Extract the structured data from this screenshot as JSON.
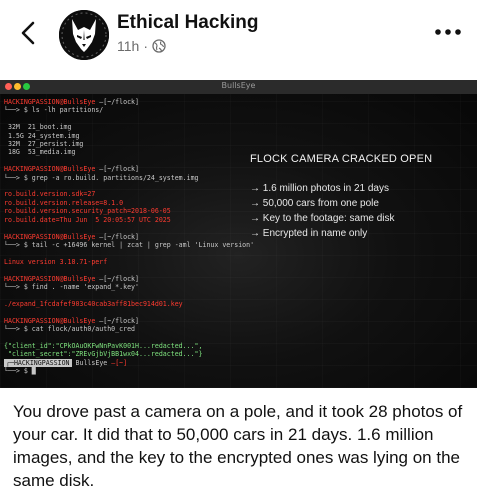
{
  "header": {
    "page_name": "Ethical Hacking",
    "post_age": "11h",
    "separator": "·",
    "audience_icon": "globe-icon",
    "back_icon": "chevron-left-icon",
    "more_icon": "more-horizontal-icon"
  },
  "terminal": {
    "window_title": "BullsEye",
    "lines": [
      [
        {
          "t": "HACKINGPASSION@BullsEye ",
          "c": "c-red"
        },
        {
          "t": "—[~/flock]",
          "c": "c-dim"
        }
      ],
      [
        {
          "t": "└──> $ ls -lh partitions/",
          "c": "c-dim"
        }
      ],
      [
        {
          "t": " ",
          "c": "c-dim"
        }
      ],
      [
        {
          "t": " 32M  21_boot.img",
          "c": "c-dim"
        }
      ],
      [
        {
          "t": " 1.5G 24_system.img",
          "c": "c-dim"
        }
      ],
      [
        {
          "t": " 32M  27_persist.img",
          "c": "c-dim"
        }
      ],
      [
        {
          "t": " 18G  53_media.img",
          "c": "c-dim"
        }
      ],
      [
        {
          "t": " ",
          "c": "c-dim"
        }
      ],
      [
        {
          "t": "HACKINGPASSION@BullsEye ",
          "c": "c-red"
        },
        {
          "t": "—[~/flock]",
          "c": "c-dim"
        }
      ],
      [
        {
          "t": "└──> $ grep -a ro.build. partitions/24_system.img",
          "c": "c-dim"
        }
      ],
      [
        {
          "t": " ",
          "c": "c-dim"
        }
      ],
      [
        {
          "t": "ro.build.version.sdk=27",
          "c": "c-red"
        }
      ],
      [
        {
          "t": "ro.build.version.release=8.1.0",
          "c": "c-red"
        }
      ],
      [
        {
          "t": "ro.build.version.security_patch=2018-06-05",
          "c": "c-red"
        }
      ],
      [
        {
          "t": "ro.build.date=Thu Jun  5 20:05:57 UTC 2025",
          "c": "c-red"
        }
      ],
      [
        {
          "t": " ",
          "c": "c-dim"
        }
      ],
      [
        {
          "t": "HACKINGPASSION@BullsEye ",
          "c": "c-red"
        },
        {
          "t": "—[~/flock]",
          "c": "c-dim"
        }
      ],
      [
        {
          "t": "└──> $ tail -c +16496 kernel | zcat | grep -aml 'Linux version'",
          "c": "c-dim"
        }
      ],
      [
        {
          "t": " ",
          "c": "c-dim"
        }
      ],
      [
        {
          "t": "Linux version 3.18.71-perf",
          "c": "c-red"
        }
      ],
      [
        {
          "t": " ",
          "c": "c-dim"
        }
      ],
      [
        {
          "t": "HACKINGPASSION@BullsEye ",
          "c": "c-red"
        },
        {
          "t": "—[~/flock]",
          "c": "c-dim"
        }
      ],
      [
        {
          "t": "└──> $ find . -name 'expand_*.key'",
          "c": "c-dim"
        }
      ],
      [
        {
          "t": " ",
          "c": "c-dim"
        }
      ],
      [
        {
          "t": "./expand_1fcdafef903c40cab3aff81bec914d01.key",
          "c": "c-red"
        }
      ],
      [
        {
          "t": " ",
          "c": "c-dim"
        }
      ],
      [
        {
          "t": "HACKINGPASSION@BullsEye ",
          "c": "c-red"
        },
        {
          "t": "—[~/flock]",
          "c": "c-dim"
        }
      ],
      [
        {
          "t": "└──> $ cat flock/auth0/auth0_cred",
          "c": "c-dim"
        }
      ],
      [
        {
          "t": " ",
          "c": "c-dim"
        }
      ],
      [
        {
          "t": "{\"client_id\":\"CPkOAuOKFwNnPavK001H...redacted...\",",
          "c": "c-green"
        }
      ],
      [
        {
          "t": " \"client_secret\":\"ZREvGjbVjBB1wx04...redacted...\"}",
          "c": "c-green"
        }
      ],
      [
        {
          "t": "┌─HACKINGPASSION",
          "c": "c-prompt-box"
        },
        {
          "t": " BullsEye ",
          "c": "c-dim"
        },
        {
          "t": "—[~]",
          "c": "c-red"
        }
      ],
      [
        {
          "t": "└──> $ ",
          "c": "c-dim"
        },
        {
          "t": "█",
          "c": "c-dim"
        }
      ]
    ]
  },
  "overlay": {
    "title": "FLOCK CAMERA CRACKED OPEN",
    "bullets": [
      "→ 1.6 million photos in 21 days",
      "→ 50,000 cars from one pole",
      "→ Key to the footage: same disk",
      "→ Encrypted in name only"
    ]
  },
  "caption": "You drove past a camera on a pole, and it took 28 photos of your car. It did that to 50,000 cars in 21 days. 1.6 million images, and the key to the encrypted ones was lying on the same disk."
}
